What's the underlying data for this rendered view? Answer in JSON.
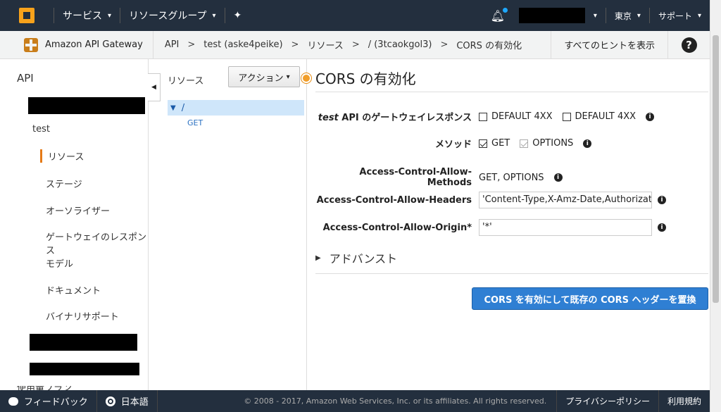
{
  "topnav": {
    "services": "サービス",
    "resource_groups": "リソースグループ",
    "region": "東京",
    "support": "サポート"
  },
  "crumbbar": {
    "service": "Amazon API Gateway",
    "crumbs": [
      "API",
      "test (aske4peike)",
      "リソース",
      "/ (3tcaokgol3)",
      "CORS の有効化"
    ],
    "separator": ">",
    "hints": "すべてのヒントを表示",
    "help": "?"
  },
  "sidebar": {
    "title": "API",
    "api_name": "test",
    "items": [
      "リソース",
      "ステージ",
      "オーソライザー",
      "ゲートウェイのレスポンス",
      "モデル",
      "ドキュメント",
      "バイナリサポート"
    ],
    "partial_bottom": "使用量プラン"
  },
  "tree": {
    "header": "リソース",
    "actions": "アクション",
    "root": "/",
    "method": "GET"
  },
  "main": {
    "title": "CORS の有効化",
    "gateway_label_em": "test",
    "gateway_label": "API のゲートウェイレスポンス",
    "gateway_opt1": "DEFAULT 4XX",
    "gateway_opt2": "DEFAULT 4XX",
    "methods_label": "メソッド",
    "method_get": "GET",
    "method_options": "OPTIONS",
    "acam_label": "Access-Control-Allow-Methods",
    "acam_value": "GET, OPTIONS",
    "acah_label": "Access-Control-Allow-Headers",
    "acah_value": "'Content-Type,X-Amz-Date,Authorization",
    "acao_label": "Access-Control-Allow-Origin*",
    "acao_value": "'*'",
    "advanced": "アドバンスト",
    "primary_button": "CORS を有効にして既存の CORS ヘッダーを置換"
  },
  "footer": {
    "feedback": "フィードバック",
    "language": "日本語",
    "copyright": "© 2008 - 2017, Amazon Web Services, Inc. or its affiliates. All rights reserved.",
    "privacy": "プライバシーポリシー",
    "terms": "利用規約"
  },
  "colors": {
    "nav_bg": "#232f3e",
    "accent_orange": "#e57a17",
    "primary_blue": "#2f7fd3"
  }
}
